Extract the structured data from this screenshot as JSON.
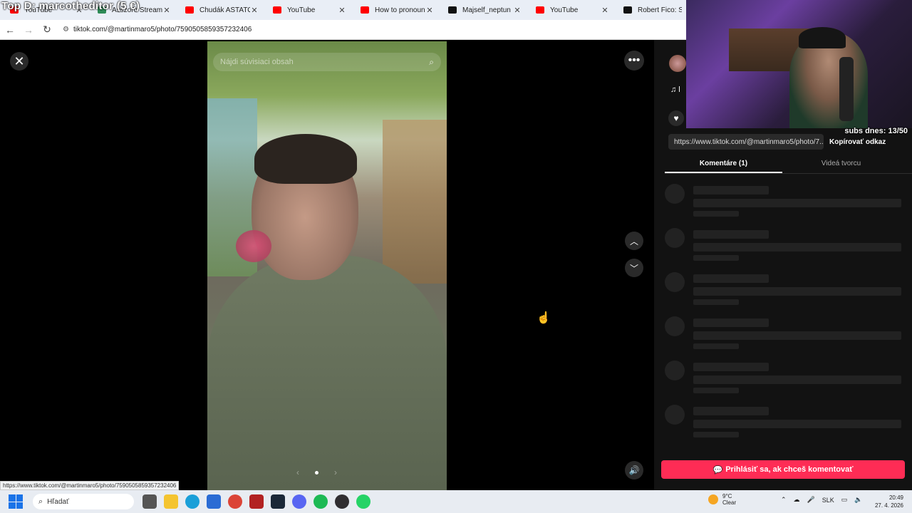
{
  "overlay": {
    "tag": "Top D: marcotheditor (5 €)"
  },
  "browser": {
    "tabs": [
      {
        "title": "YouTube",
        "favicon": "youtube"
      },
      {
        "title": "Asszoro Stream - Wi",
        "favicon": "sheet"
      },
      {
        "title": "Chudák ASTATORO",
        "favicon": "youtube"
      },
      {
        "title": "YouTube",
        "favicon": "youtube"
      },
      {
        "title": "How to pronounce n",
        "favicon": "youtube"
      },
      {
        "title": "Majself_neptun (@m",
        "favicon": "tiktok"
      },
      {
        "title": "YouTube",
        "favicon": "youtube"
      },
      {
        "title": "Robert Fico: Sl",
        "favicon": "tiktok"
      }
    ],
    "url": "tiktok.com/@martinmaro5/photo/7590505859357232406",
    "status_link": "https://www.tiktok.com/@martinmaro5/photo/7590505859357232406"
  },
  "viewer": {
    "search_placeholder": "Nájdi súvisiaci obsah",
    "carousel_current": 1,
    "carousel_total": 1
  },
  "webcam": {
    "subs_text": "subs dnes: 13/50"
  },
  "panel": {
    "music_text": "♫ l",
    "link_url": "https://www.tiktok.com/@martinmaro5/photo/7...",
    "copy_link": "Kopírovať odkaz",
    "tabs": [
      {
        "label": "Komentáre (1)",
        "active": true
      },
      {
        "label": "Videá tvorcu",
        "active": false
      }
    ],
    "comment_button": "Prihlásiť sa, ak chceš komentovať"
  },
  "taskbar": {
    "search_placeholder": "Hľadať",
    "weather_temp": "9°C",
    "weather_desc": "Clear",
    "weather_badge": "1",
    "language": "SLK",
    "time": "20:49",
    "date": "27. 4. 2026"
  },
  "colors": {
    "accent": "#fe2c55",
    "panel_bg": "#121212",
    "taskbar_bg": "#e8ecf2"
  }
}
